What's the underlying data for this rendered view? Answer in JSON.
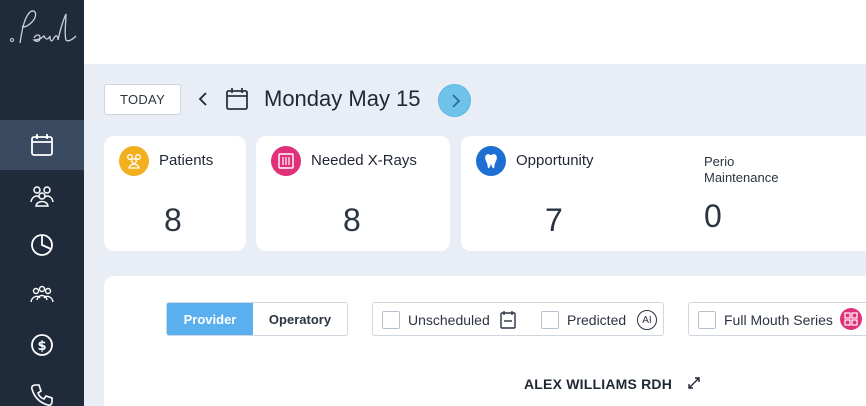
{
  "sidebar": {
    "logo_text": "pearl",
    "items": [
      {
        "icon": "calendar-icon",
        "active": true
      },
      {
        "icon": "patients-group-icon",
        "active": false
      },
      {
        "icon": "pie-chart-icon",
        "active": false
      },
      {
        "icon": "team-icon",
        "active": false
      },
      {
        "icon": "dollar-icon",
        "active": false
      },
      {
        "icon": "phone-icon",
        "active": false
      }
    ]
  },
  "header": {
    "today_label": "TODAY",
    "date_title": "Monday May 15"
  },
  "stats": {
    "patients": {
      "label": "Patients",
      "value": "8",
      "icon": "patients-icon",
      "color": "#f2b01e"
    },
    "xrays": {
      "label": "Needed X-Rays",
      "value": "8",
      "icon": "xray-icon",
      "color": "#e0307a"
    },
    "opportunity": {
      "label": "Opportunity",
      "value": "7",
      "icon": "tooth-icon",
      "color": "#1d6fd1"
    },
    "perio": {
      "label_line1": "Perio",
      "label_line2": "Maintenance",
      "value": "0"
    }
  },
  "view_toggle": {
    "provider_label": "Provider",
    "operatory_label": "Operatory",
    "selected": "Provider"
  },
  "filters": {
    "unscheduled_label": "Unscheduled",
    "predicted_label": "Predicted",
    "predicted_badge": "AI",
    "full_mouth_label": "Full Mouth Series"
  },
  "schedule": {
    "provider_name": "ALEX WILLIAMS RDH"
  },
  "colors": {
    "sidebar": "#1f2a3b",
    "accent": "#5ab0ef",
    "background": "#e9eef6"
  }
}
